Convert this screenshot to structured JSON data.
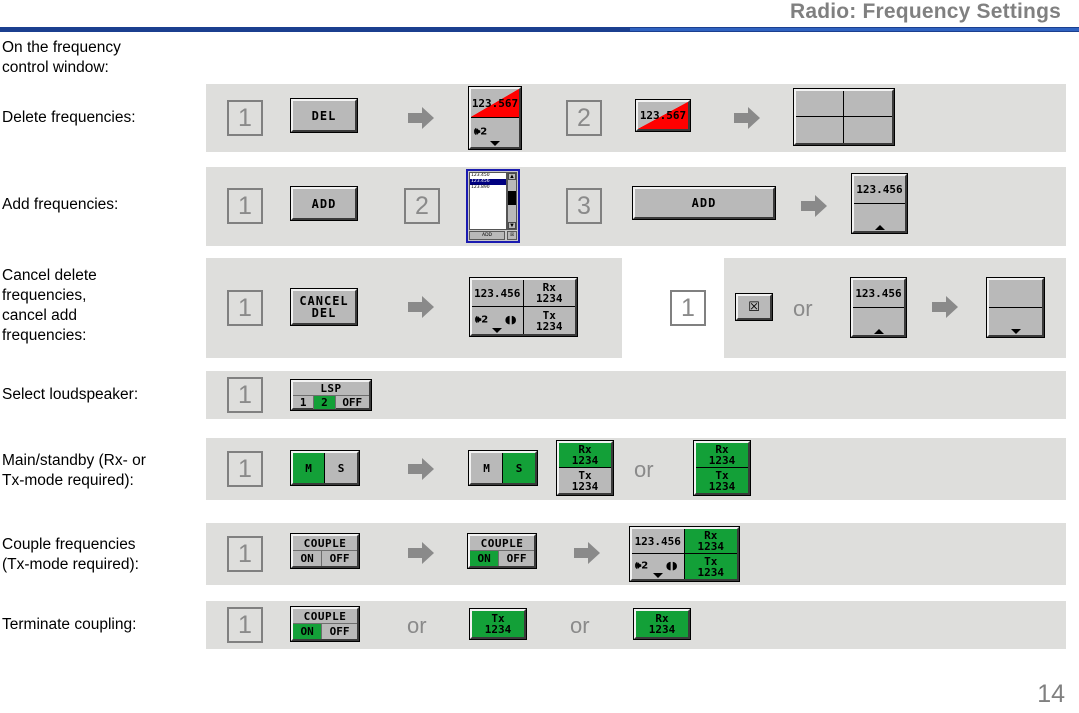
{
  "header": {
    "title": "Radio: Frequency Settings"
  },
  "footer": {
    "page_number": "14"
  },
  "labels": {
    "intro": "On the frequency\ncontrol window:",
    "delete": "Delete frequencies:",
    "add": "Add frequencies:",
    "cancel": "Cancel delete\nfrequencies,\ncancel add\nfrequencies:",
    "loudspeaker": "Select loudspeaker:",
    "mainstandby": "Main/standby (Rx- or\nTx-mode required):",
    "couple": "Couple frequencies\n(Tx-mode required):",
    "terminate": "Terminate coupling:"
  },
  "common": {
    "or": "or",
    "step1": "1",
    "step2": "2",
    "step3": "3",
    "arrow_icon": "right-arrow-icon",
    "caret_down_icon": "caret-down-icon",
    "caret_up_icon": "caret-up-icon",
    "speaker_icon": "speaker-icon",
    "speaker_channel": "2",
    "rings_icon": "coupled-rings-icon",
    "close_glyph": "☒"
  },
  "colors": {
    "header_rule": "#1b3f8f",
    "header_title": "#808080",
    "panel_bg": "#dededc",
    "button_face": "#b9b9b9",
    "active_green": "#13a038",
    "alert_red": "#ff0000",
    "dialog_border": "#1b1bb0",
    "selection_blue": "#000080"
  },
  "rows": {
    "delete": {
      "del_button": "DEL",
      "freq_value": "123.567",
      "freq_value_after": "123.567"
    },
    "add": {
      "add_button_small": "ADD",
      "add_button_large": "ADD",
      "freq_value": "123.456",
      "dialog": {
        "items": [
          "123.450",
          "123.456",
          "123.890"
        ],
        "selected_index": 1,
        "ok_label": "ADD",
        "close_label": "☒"
      }
    },
    "cancel": {
      "cancel_button_line1": "CANCEL",
      "cancel_button_line2": "DEL",
      "freq_value": "123.456",
      "rx_label": "Rx\n1234",
      "tx_label": "Tx\n1234",
      "close_button": "☒",
      "freq_value_2": "123.456"
    },
    "loudspeaker": {
      "caption": "LSP",
      "segments": [
        "1",
        "2",
        "OFF"
      ],
      "active_segment": "2"
    },
    "mainstandby": {
      "before": {
        "m": "M",
        "s": "S",
        "active": "M"
      },
      "after": {
        "m": "M",
        "s": "S",
        "active": "S"
      },
      "option_a": {
        "rx": "Rx\n1234",
        "tx": "Tx\n1234",
        "rx_active": true,
        "tx_active": false
      },
      "option_b": {
        "rx": "Rx\n1234",
        "tx": "Tx\n1234",
        "rx_active": true,
        "tx_active": true
      }
    },
    "couple": {
      "caption": "COUPLE",
      "on_label": "ON",
      "off_label": "OFF",
      "active_before": "",
      "active_after": "ON",
      "freq_value": "123.456",
      "rx_label": "Rx\n1234",
      "tx_label": "Tx\n1234"
    },
    "terminate": {
      "caption": "COUPLE",
      "on_label": "ON",
      "off_label": "OFF",
      "active": "ON",
      "tx_label": "Tx\n1234",
      "rx_label": "Rx\n1234"
    }
  }
}
